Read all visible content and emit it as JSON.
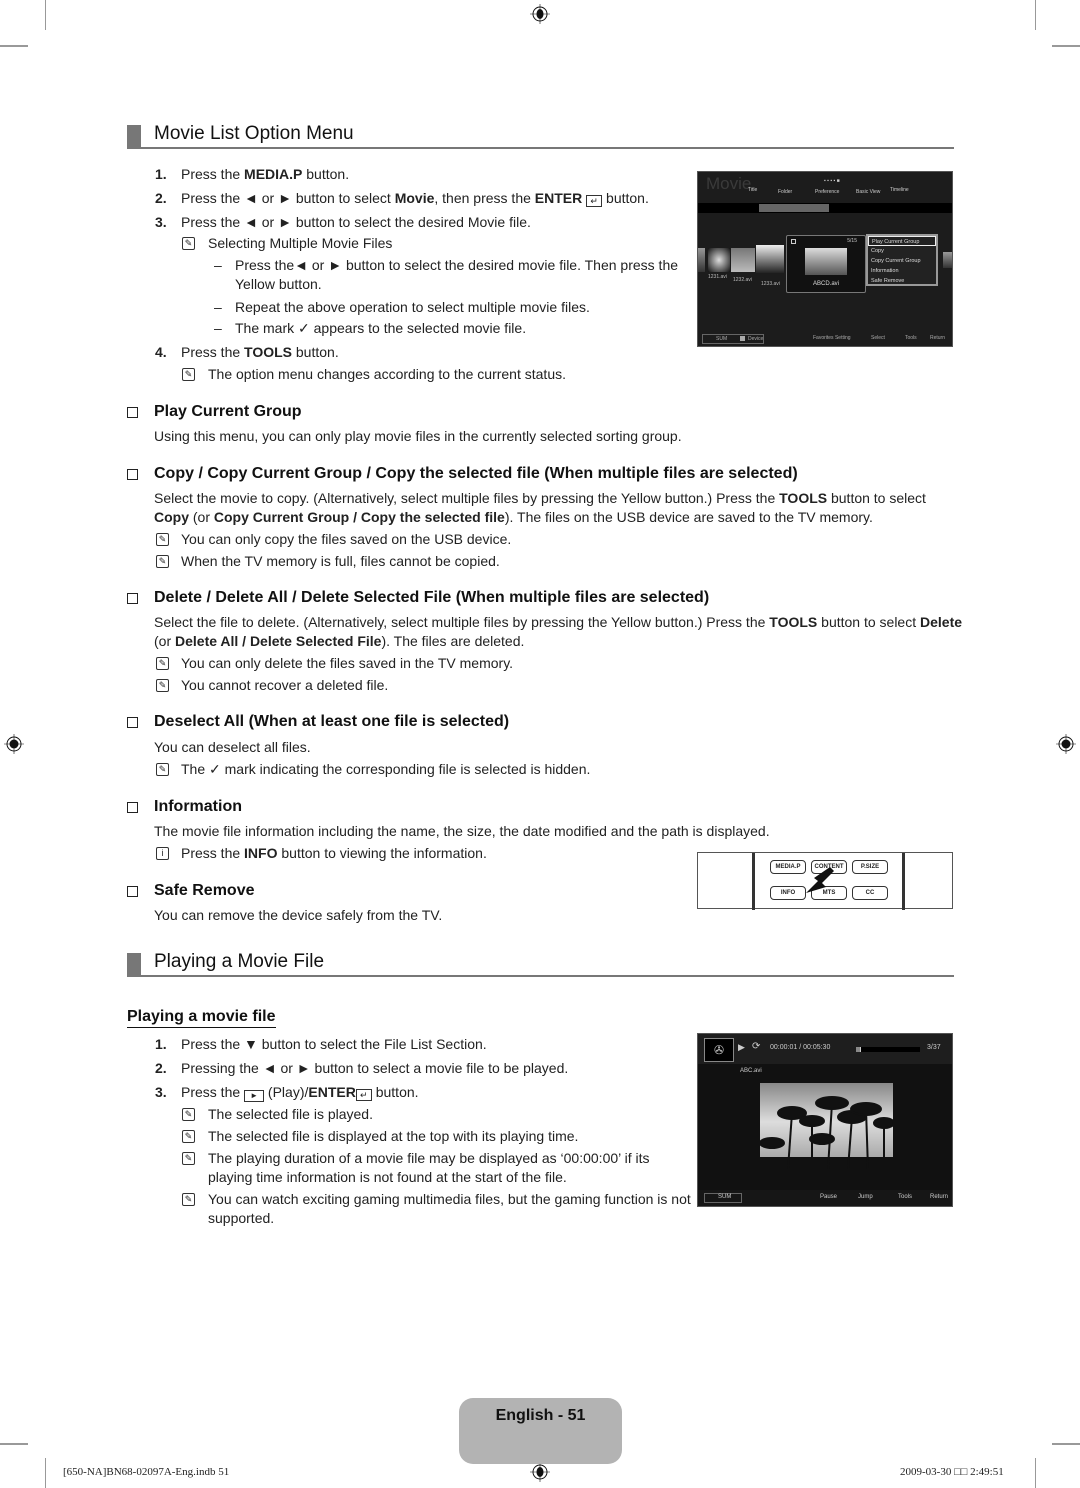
{
  "section1": {
    "title": "Movie List Option Menu",
    "steps": [
      {
        "num": "1.",
        "pre": "Press the ",
        "bold": "MEDIA.P",
        "post": " button."
      },
      {
        "num": "2.",
        "text": "Press the ◄ or ► button to select ",
        "bold1": "Movie",
        "mid": ", then press the ",
        "bold2": "ENTER",
        "post": " button."
      },
      {
        "num": "3.",
        "text": "Press the ◄ or ► button to select the desired Movie file."
      },
      {
        "num": "4.",
        "pre": "Press the ",
        "bold": "TOOLS",
        "post": " button."
      }
    ],
    "note_multi": "Selecting Multiple Movie Files",
    "bullets": [
      "Press the◄ or ► button to select the desired movie file. Then press the",
      "Yellow button.",
      "Repeat the above operation to select multiple movie files.",
      "The mark",
      "appears to the selected movie file."
    ],
    "note_status": "The option menu changes according to the current status.",
    "dash": "–",
    "check": "✓"
  },
  "tv_movie_list": {
    "title": "Movie",
    "tabs": [
      "Title",
      "Folder",
      "Preference",
      "Basic View",
      "Timeline"
    ],
    "files": [
      "1231.avi",
      "1232.avi",
      "1233.avi"
    ],
    "selected_file": "ABCD.avi",
    "counter": "5/15",
    "menu": [
      "Play Current Group",
      "Copy",
      "Copy Current Group",
      "Information",
      "Safe Remove"
    ],
    "footer": {
      "device_label": "SUM",
      "device": "Device",
      "fav": "Favorites Setting",
      "select": "Select",
      "tools": "Tools",
      "return": "Return"
    }
  },
  "options": [
    {
      "title": "Play Current Group",
      "body": "Using this menu, you can only play movie files in the currently selected sorting group."
    },
    {
      "title": "Copy / Copy Current Group / Copy the selected file (When multiple files are selected)",
      "body1": "Select the movie to copy. (Alternatively, select multiple files by pressing the Yellow button.) Press the ",
      "body1_bold": "TOOLS",
      "body1_post": " button to select",
      "body2_bold1": "Copy",
      "body2_mid": " (or ",
      "body2_bold2": "Copy Current Group / Copy the selected file",
      "body2_post": "). The files on the USB device are saved to the TV memory.",
      "notes": [
        "You can only copy the files saved on the USB device.",
        "When the TV memory is full, files cannot be copied."
      ]
    },
    {
      "title": "Delete / Delete All / Delete Selected File (When multiple files are selected)",
      "body1": "Select the file to delete. (Alternatively, select multiple files by pressing the Yellow button.) Press the ",
      "body1_bold": "TOOLS",
      "body1_mid": " button to select ",
      "body1_bold2": "Delete",
      "body2_pre": "(or ",
      "body2_bold": "Delete All / Delete Selected File",
      "body2_post": "). The files are deleted.",
      "notes": [
        "You can only delete the files saved in the TV memory.",
        "You cannot recover a deleted file."
      ]
    },
    {
      "title": "Deselect All (When at least one file is selected)",
      "body": "You can deselect all files.",
      "note_pre": "The",
      "note_post": "mark indicating the corresponding file is selected is hidden."
    },
    {
      "title": "Information",
      "body": "The movie file information including the name, the size, the date modified and the path is displayed.",
      "note_pre": "Press the ",
      "note_bold": "INFO",
      "note_post": " button to viewing the information."
    },
    {
      "title": "Safe Remove",
      "body": "You can remove the device safely from the TV."
    }
  ],
  "remote": {
    "buttons": [
      "MEDIA.P",
      "CONTENT",
      "P.SIZE",
      "INFO",
      "MTS",
      "CC"
    ]
  },
  "section2": {
    "title": "Playing a Movie File",
    "subtitle": "Playing a movie file",
    "steps": [
      {
        "num": "1.",
        "text": "Press the ▼ button to select the File List Section."
      },
      {
        "num": "2.",
        "text": "Pressing the ◄ or ► button to select a movie file to be played."
      },
      {
        "num": "3.",
        "pre": "Press the ",
        "mid": " (Play)/",
        "bold": "ENTER",
        "post": " button."
      }
    ],
    "notes": [
      "The selected file is played.",
      "The selected file is displayed at the top with its playing time.",
      "The playing duration of a movie file may be displayed as ‘00:00:00’ if its",
      "playing time information is not found at the start of the file.",
      "You can watch exciting gaming multimedia files, but the gaming function is not",
      "supported."
    ]
  },
  "tv_player": {
    "time": "00:00:01 / 00:05:30",
    "progress_fraction": 0.003,
    "counter": "3/37",
    "file": "ABC.avi",
    "footer": {
      "sum": "SUM",
      "pause": "Pause",
      "jump": "Jump",
      "tools": "Tools",
      "return": "Return"
    }
  },
  "page": {
    "label": "English - 51"
  },
  "footer": {
    "left": "[650-NA]BN68-02097A-Eng.indb   51",
    "right": "2009-03-30   □□ 2:49:51"
  }
}
